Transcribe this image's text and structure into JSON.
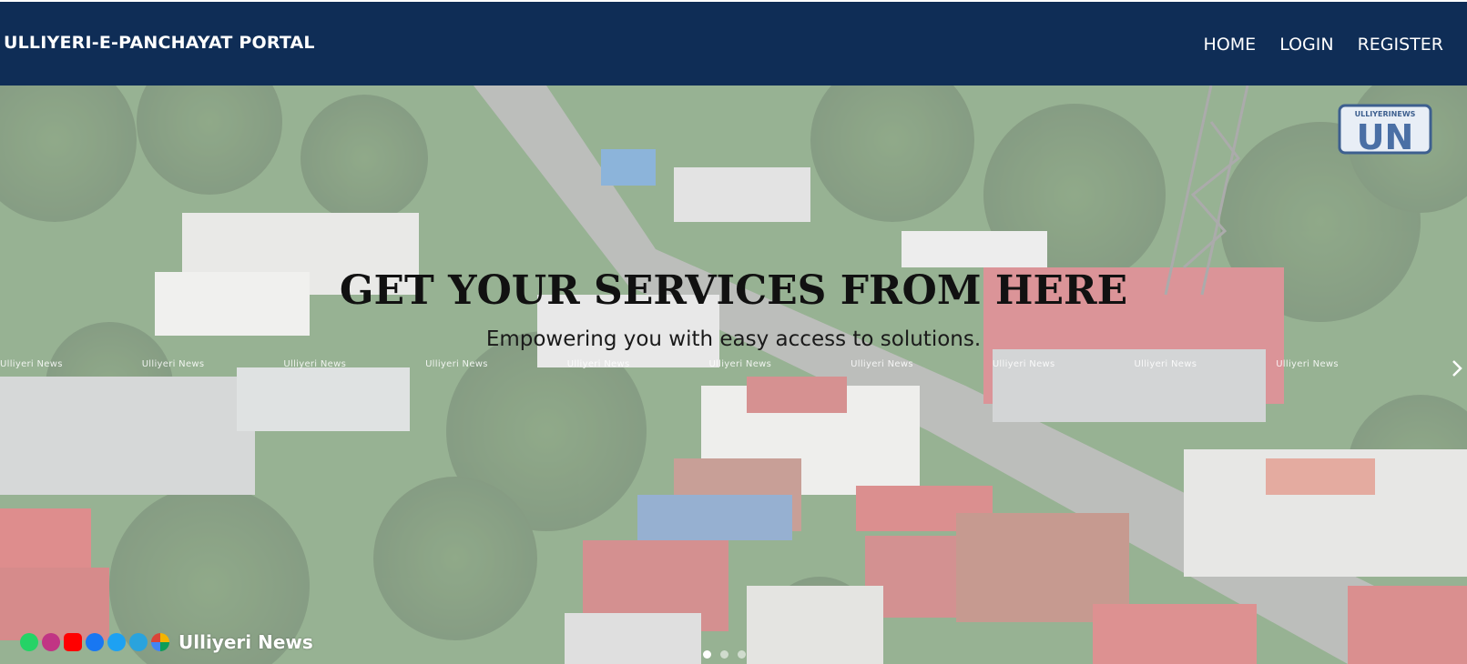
{
  "header": {
    "brand": "ULLIYERI-E-PANCHAYAT PORTAL",
    "nav": [
      "HOME",
      "LOGIN",
      "REGISTER"
    ],
    "background_color": "#0f2d56"
  },
  "hero": {
    "title": "GET YOUR SERVICES FROM HERE",
    "subtitle": "Empowering you with easy access to solutions.",
    "watermark_text": "Ulliyeri News",
    "channel_logo": {
      "top_text": "ULLIYERINEWS",
      "letters": "UN"
    },
    "social_name": "Ulliyeri News",
    "social_icons": [
      "whatsapp-icon",
      "instagram-icon",
      "youtube-icon",
      "facebook-icon",
      "twitter-icon",
      "telegram-icon",
      "apps-icon"
    ],
    "carousel": {
      "active_index": 0,
      "count": 3
    }
  }
}
